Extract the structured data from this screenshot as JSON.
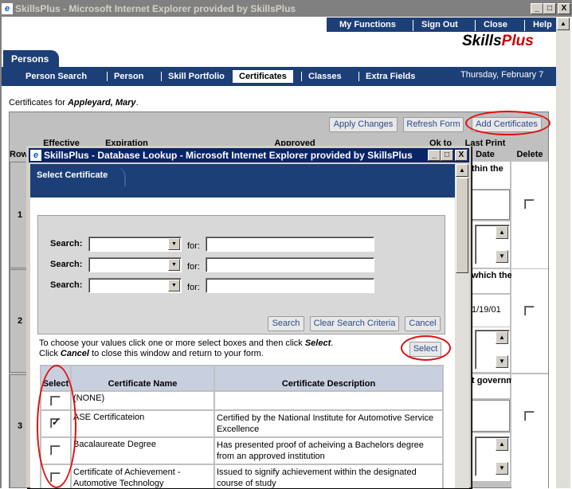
{
  "main_window": {
    "title": "SkillsPlus - Microsoft Internet Explorer provided by SkillsPlus",
    "icon": "ie-icon",
    "controls": [
      "_",
      "□",
      "X"
    ]
  },
  "top_nav": {
    "items": [
      "My Functions",
      "Sign Out",
      "Close",
      "Help"
    ],
    "logo_part1": "Skills",
    "logo_part2": "Plus"
  },
  "module_tab": "Persons",
  "sub_nav": {
    "items": [
      "Person Search",
      "Person",
      "Skill Portfolio",
      "Certificates",
      "Classes",
      "Extra Fields"
    ],
    "active": "Certificates",
    "date": "Thursday, February 7"
  },
  "context": {
    "prefix": "Certificates for ",
    "name": "Appleyard, Mary",
    "suffix": "."
  },
  "actions": {
    "apply": "Apply Changes",
    "refresh": "Refresh Form",
    "add": "Add Certificates"
  },
  "table_headers": {
    "row": "Row",
    "effective": "Effective",
    "expiration": "Expiration",
    "approved": "Approved",
    "ok_to": "Ok to",
    "last_print": "Last Print",
    "date": "Date",
    "delete": "Delete"
  },
  "rows": [
    {
      "num": "1",
      "desc_fragment": "thin the",
      "last_print": ""
    },
    {
      "num": "2",
      "desc_fragment": " which the",
      "last_print": "1/19/01"
    },
    {
      "num": "3",
      "desc_fragment": "t government",
      "last_print": ""
    }
  ],
  "popup": {
    "title": "SkillsPlus - Database Lookup - Microsoft Internet Explorer provided by SkillsPlus",
    "controls": [
      "_",
      "□",
      "X"
    ],
    "tab": "Select Certificate",
    "search_label": "Search:",
    "for_label": "for:",
    "search_rows": 3,
    "buttons": {
      "search": "Search",
      "clear": "Clear Search Criteria",
      "cancel": "Cancel",
      "select": "Select"
    },
    "instructions": {
      "line1_a": "To choose your values click one or more select boxes and then click ",
      "line1_b": "Select",
      "line1_c": ".",
      "line2_a": "Click ",
      "line2_b": "Cancel",
      "line2_c": " to close this window and return to your form."
    },
    "columns": {
      "select": "Select",
      "name": "Certificate Name",
      "description": "Certificate Description"
    },
    "certificates": [
      {
        "name": "(NONE)",
        "description": "",
        "checked": false
      },
      {
        "name": "ASE Certificateion",
        "description": "Certified by the National Institute for Automotive Service Excellence",
        "checked": true
      },
      {
        "name": "Bacalaureate Degree",
        "description": "Has presented proof of acheiving a Bachelors degree from an approved institution",
        "checked": false
      },
      {
        "name": "Certificate of Achievement - Automotive Technology",
        "description": "Issued to signify achievement within the designated course of study",
        "checked": false
      }
    ]
  },
  "colors": {
    "nav_blue": "#1c3f78",
    "titlebar_active": "#0a246a",
    "highlight_red": "#e01010",
    "logo_red": "#cc0000"
  }
}
